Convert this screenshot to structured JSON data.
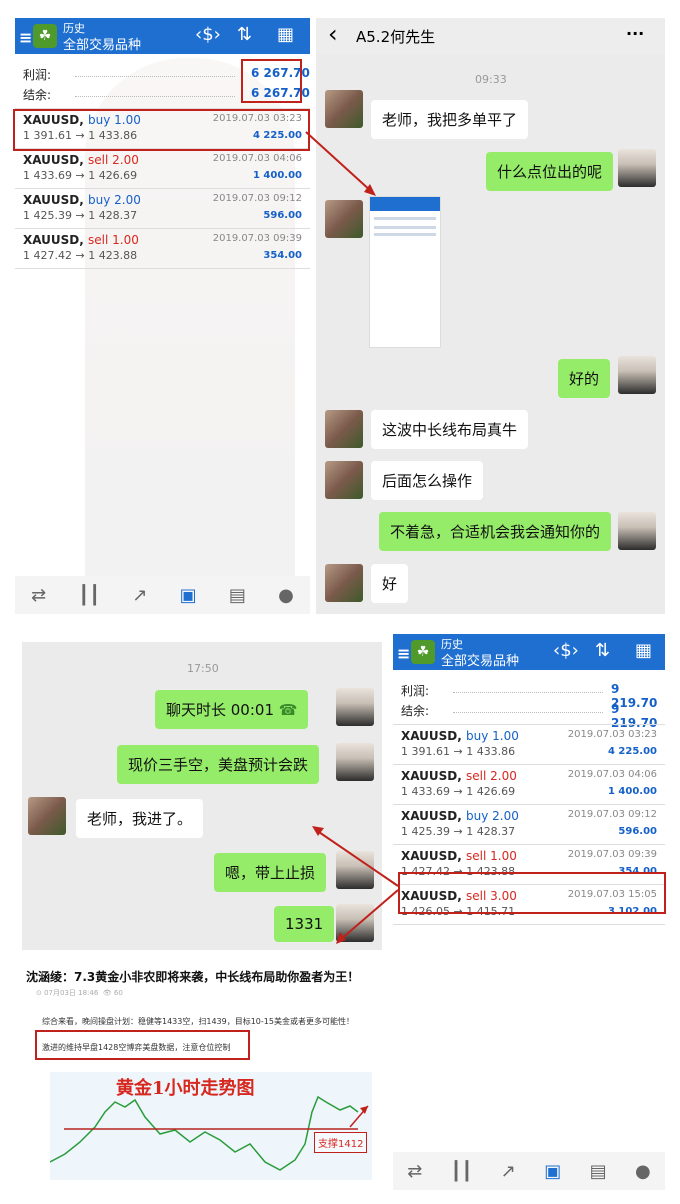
{
  "mt_common": {
    "title_small": "历史",
    "title_main": "全部交易品种",
    "hamburger": "≡",
    "icon_sort": "⇅",
    "icon_calendar": "▦",
    "icon_money": "$",
    "profit_label": "利润:",
    "balance_label": "结余:"
  },
  "mt_top": {
    "profit": "6 267.70",
    "balance": "6 267.70",
    "trades": [
      {
        "symbol": "XAUUSD,",
        "side": "buy 1.00",
        "prices": "1 391.61 → 1 433.86",
        "date": "2019.07.03 03:23",
        "pl": "4 225.00",
        "type": "buy"
      },
      {
        "symbol": "XAUUSD,",
        "side": "sell 2.00",
        "prices": "1 433.69 → 1 426.69",
        "date": "2019.07.03 04:06",
        "pl": "1 400.00",
        "type": "sell"
      },
      {
        "symbol": "XAUUSD,",
        "side": "buy 2.00",
        "prices": "1 425.39 → 1 428.37",
        "date": "2019.07.03 09:12",
        "pl": "596.00",
        "type": "buy"
      },
      {
        "symbol": "XAUUSD,",
        "side": "sell 1.00",
        "prices": "1 427.42 → 1 423.88",
        "date": "2019.07.03 09:39",
        "pl": "354.00",
        "type": "sell"
      }
    ]
  },
  "mt_bottom": {
    "profit": "9 219.70",
    "balance": "9 219.70",
    "trades": [
      {
        "symbol": "XAUUSD,",
        "side": "buy 1.00",
        "prices": "1 391.61 → 1 433.86",
        "date": "2019.07.03 03:23",
        "pl": "4 225.00",
        "type": "buy"
      },
      {
        "symbol": "XAUUSD,",
        "side": "sell 2.00",
        "prices": "1 433.69 → 1 426.69",
        "date": "2019.07.03 04:06",
        "pl": "1 400.00",
        "type": "sell"
      },
      {
        "symbol": "XAUUSD,",
        "side": "buy 2.00",
        "prices": "1 425.39 → 1 428.37",
        "date": "2019.07.03 09:12",
        "pl": "596.00",
        "type": "buy"
      },
      {
        "symbol": "XAUUSD,",
        "side": "sell 1.00",
        "prices": "1 427.42 → 1 423.88",
        "date": "2019.07.03 09:39",
        "pl": "354.00",
        "type": "sell"
      },
      {
        "symbol": "XAUUSD,",
        "side": "sell 3.00",
        "prices": "1 426.05 → 1 415.71",
        "date": "2019.07.03 15:05",
        "pl": "3 102.00",
        "type": "sell"
      }
    ]
  },
  "chat_top": {
    "back": "‹",
    "contact": "A5.2何先生",
    "more": "···",
    "time": "09:33",
    "msgs": {
      "m1": "老师，我把多单平了",
      "m2": "什么点位出的呢",
      "m3": "好的",
      "m4": "这波中长线布局真牛",
      "m5": "后面怎么操作",
      "m6": "不着急，合适机会我会通知你的",
      "m7": "好"
    }
  },
  "chat_bottom": {
    "time": "17:50",
    "msgs": {
      "m1": "聊天时长 00:01",
      "m2": "现价三手空，美盘预计会跌",
      "m3": "老师，我进了。",
      "m4": "嗯，带上止损",
      "m5": "1331"
    }
  },
  "article": {
    "title": "沈涵绫：7.3黄金小非农即将来袭，中长线布局助你盈者为王！",
    "meta_date": "07月03日 18:46",
    "meta_views": "60",
    "line1": "综合来看，晚间操盘计划：稳健等1433空，扫1439，目标10-15美金或者更多可能性！",
    "line2": "激进的维持早盘1428空博弈美盘数据，注意仓位控制",
    "chart_title": "黄金1小时走势图",
    "support": "支撑1412"
  }
}
